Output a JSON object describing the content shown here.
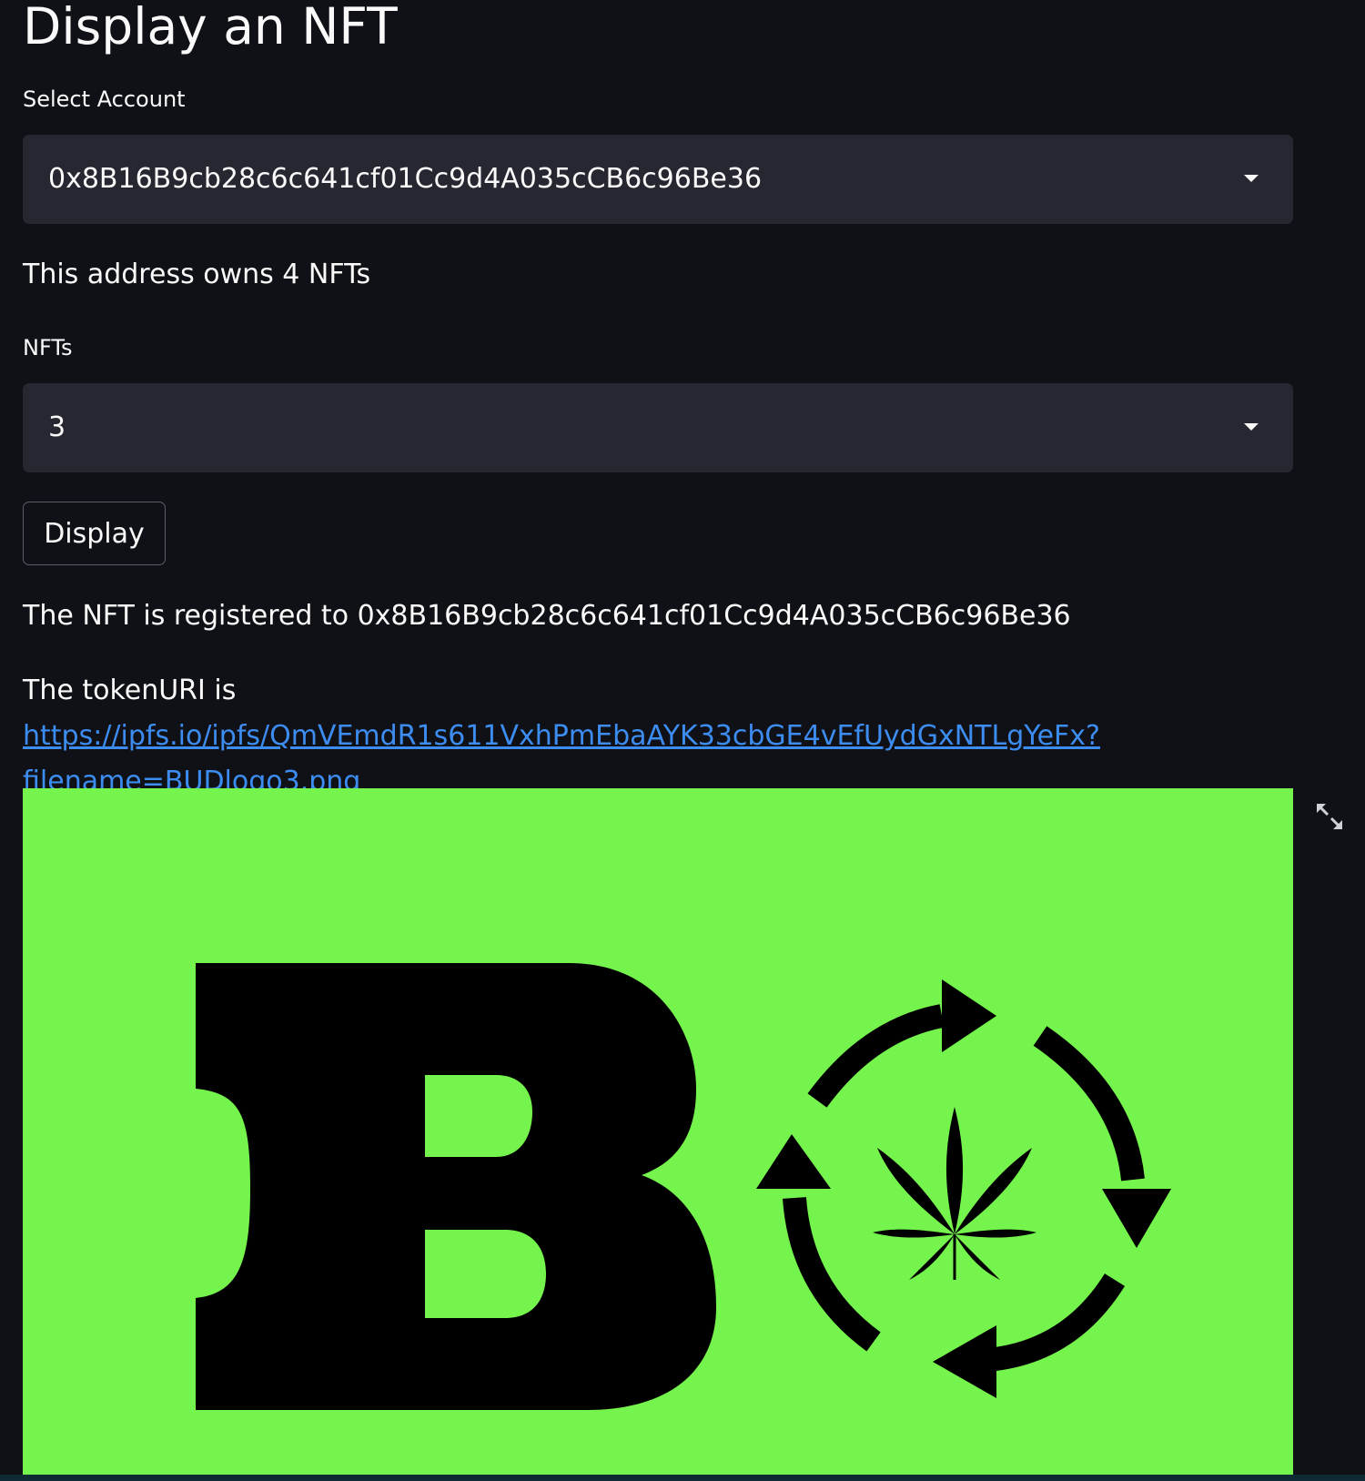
{
  "page": {
    "title": "Display an NFT"
  },
  "account": {
    "label": "Select Account",
    "selected": "0x8B16B9cb28c6c641cf01Cc9d4A035cCB6c96Be36"
  },
  "ownership": {
    "text": "This address owns 4 NFTs"
  },
  "nfts": {
    "label": "NFTs",
    "selected": "3"
  },
  "actions": {
    "display_label": "Display"
  },
  "result": {
    "registered_text": "The NFT is registered to 0x8B16B9cb28c6c641cf01Cc9d4A035cCB6c96Be36",
    "token_uri_prefix": "The tokenURI is ",
    "token_uri": "https://ipfs.io/ipfs/QmVEmdR1s611VxhPmEbaAYK33cbGE4vEfUydGxNTLgYeFx?filename=BUDlogo3.png"
  },
  "image": {
    "background_color": "#74f44c",
    "logo_color": "#000000",
    "icons": [
      "letter-b-logo",
      "cannabis-leaf-icon",
      "circular-recycle-arrows-icon"
    ]
  },
  "toolbar": {
    "fullscreen_icon": "expand-icon"
  }
}
